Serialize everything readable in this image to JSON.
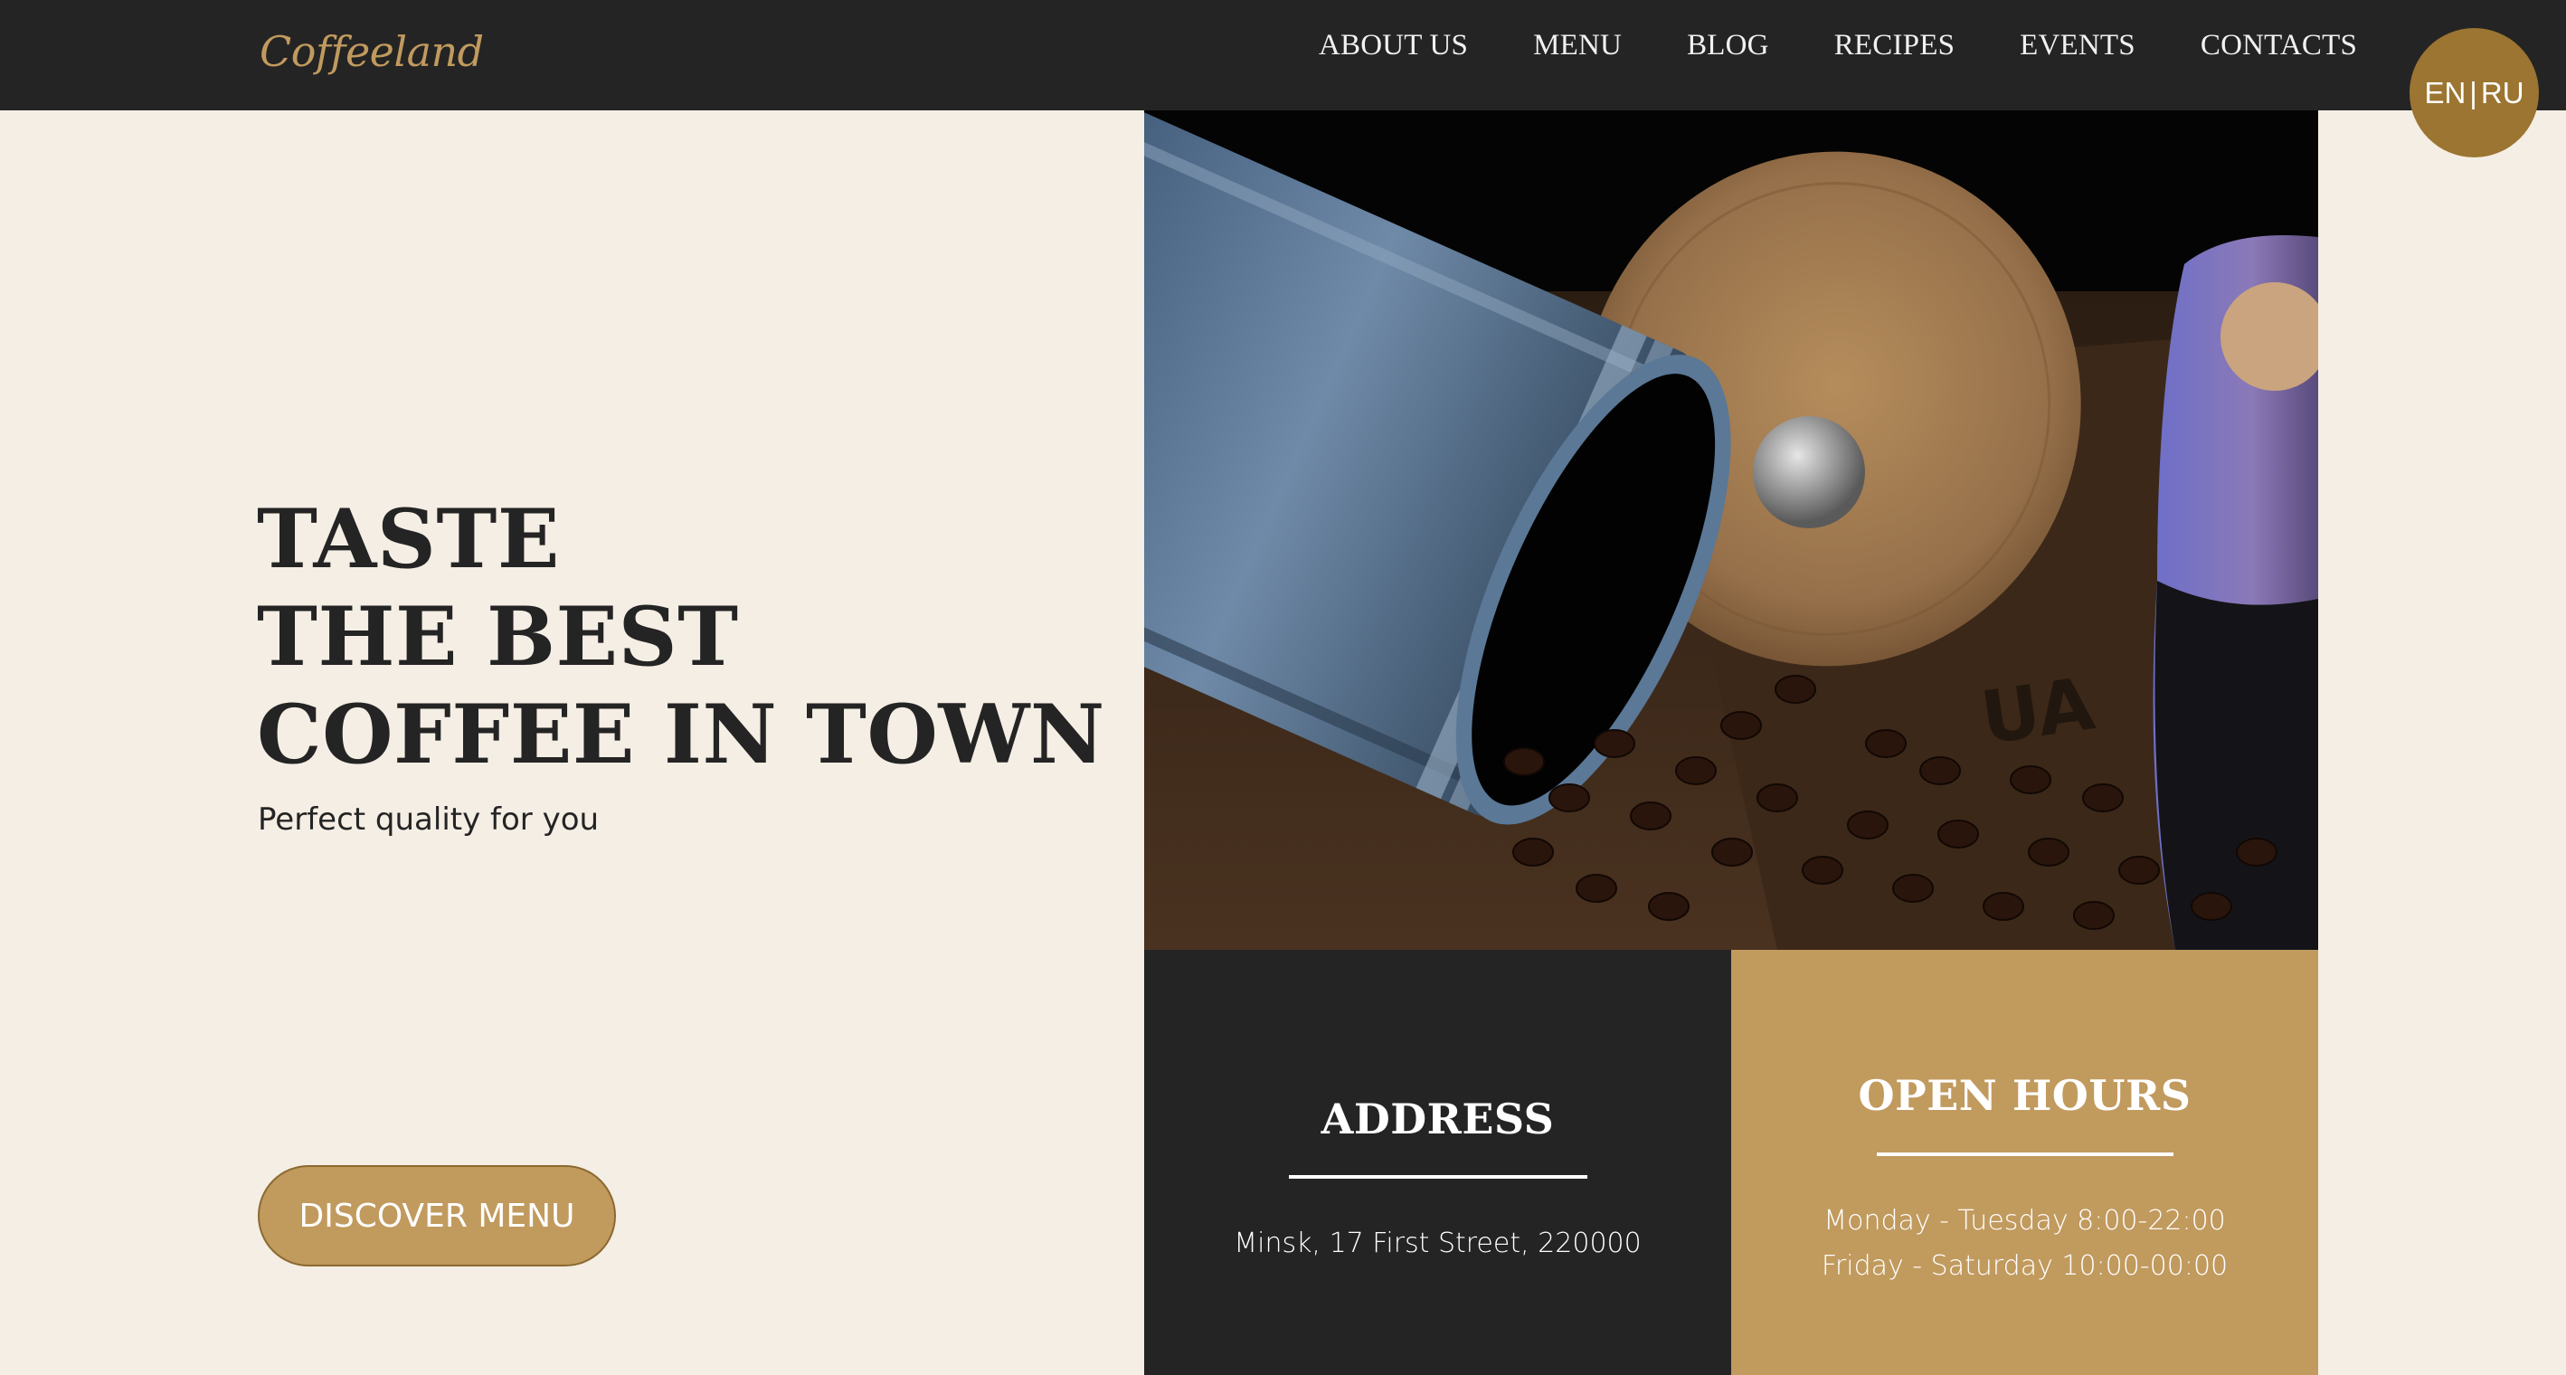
{
  "header": {
    "logo": "Coffeeland",
    "nav": [
      "ABOUT US",
      "MENU",
      "BLOG",
      "RECIPES",
      "EVENTS",
      "CONTACTS"
    ],
    "lang": {
      "en": "EN",
      "separator": "|",
      "ru": "RU"
    }
  },
  "hero": {
    "title_lines": [
      "TASTE",
      "THE BEST",
      "COFFEE IN TOWN"
    ],
    "subtitle": "Perfect quality for you",
    "cta": "DISCOVER MENU"
  },
  "address": {
    "title": "ADDRESS",
    "text": "Minsk, 17 First Street, 220000"
  },
  "hours": {
    "title": "OPEN HOURS",
    "lines": [
      "Monday - Tuesday 8:00-22:00",
      "Friday - Saturday 10:00-00:00"
    ]
  },
  "colors": {
    "header_bg": "#242424",
    "accent": "#c19a5e",
    "badge": "#9b7531",
    "page_bg": "#f5eee4",
    "text_dark": "#242424"
  }
}
